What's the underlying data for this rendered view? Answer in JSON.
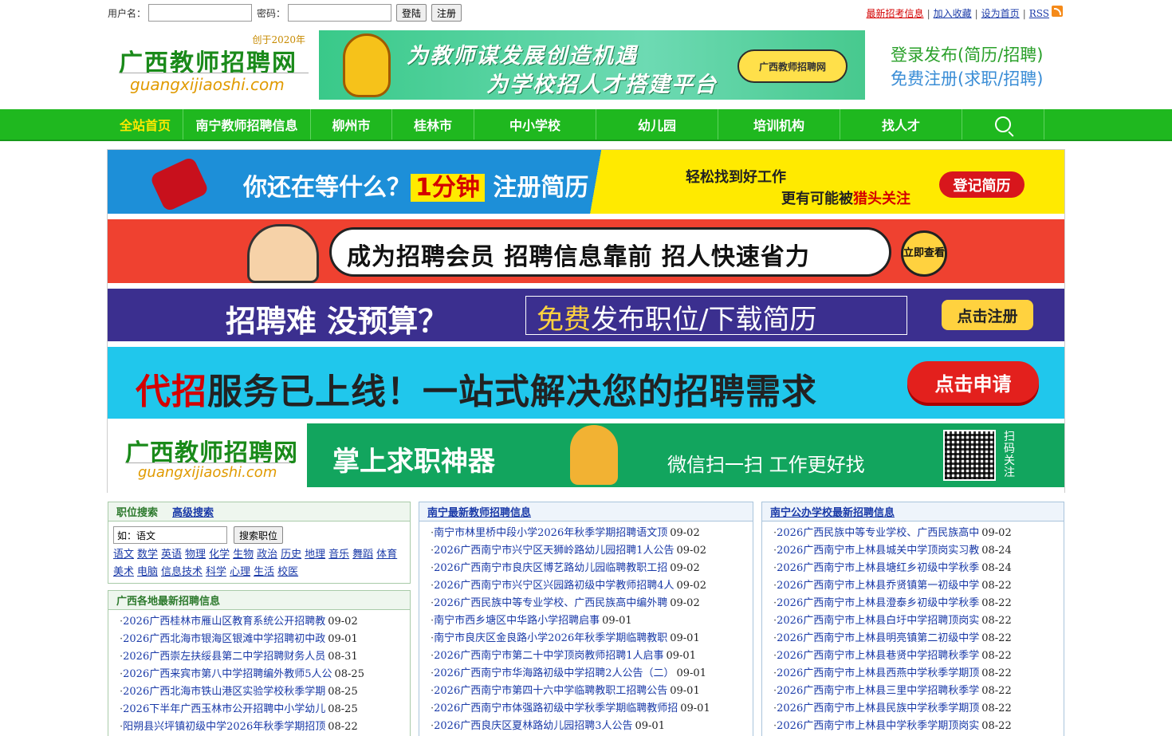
{
  "login": {
    "user_label": "用户名：",
    "pass_label": "密码：",
    "login_btn": "登陆",
    "register_btn": "注册"
  },
  "toplinks": {
    "latest": "最新招考信息",
    "favorite": "加入收藏",
    "homepage": "设为首页",
    "rss": "RSS",
    "sep": "|"
  },
  "logo": {
    "founded": "创于2020年",
    "cn": "广西教师招聘网",
    "en": "guangxijiaoshi.com"
  },
  "hero": {
    "line1": "为教师谋发展创造机遇",
    "line2": "为学校招人才搭建平台",
    "badge": "广西教师招聘网"
  },
  "header_right": {
    "login_post": "登录发布(简历/招聘)",
    "free_register": "免费注册(求职/招聘)"
  },
  "nav": [
    {
      "label": "全站首页",
      "width": 95
    },
    {
      "label": "南宁教师招聘信息",
      "width": 160
    },
    {
      "label": "柳州市",
      "width": 102
    },
    {
      "label": "桂林市",
      "width": 103
    },
    {
      "label": "中小学校",
      "width": 153
    },
    {
      "label": "幼儿园",
      "width": 153
    },
    {
      "label": "培训机构",
      "width": 153
    },
    {
      "label": "找人才",
      "width": 153
    }
  ],
  "ads": {
    "a1_main": "你还在等什么？",
    "a1_hl": "1分钟",
    "a1_tail": "注册简历",
    "a1_sub1": "轻松找到好工作",
    "a1_sub2a": "更有可能被",
    "a1_sub2b": "猎头关注",
    "a1_btn": "登记简历",
    "a2_text": "成为招聘会员  招聘信息靠前  招人快速省力",
    "a2_go": "立即查看",
    "a3_main": "招聘难 没预算？",
    "a3_free": "免费",
    "a3_rest": "发布职位/下载简历",
    "a3_btn": "点击注册",
    "a4_red": "代招",
    "a4_rest": "服务已上线！一站式解决您的招聘需求",
    "a4_btn": "点击申请",
    "a5_cn": "广西教师招聘网",
    "a5_en": "guangxijiaoshi.com",
    "a5_main": "掌上求职神器",
    "a5_sub": "微信扫一扫 工作更好找",
    "a5_scan": "扫码关注"
  },
  "search": {
    "title": "职位搜索",
    "advanced": "高级搜索",
    "placeholder": "如：语文",
    "button": "搜索职位",
    "tags": [
      "语文",
      "数学",
      "英语",
      "物理",
      "化学",
      "生物",
      "政治",
      "历史",
      "地理",
      "音乐",
      "舞蹈",
      "体育",
      "美术",
      "电脑",
      "信息技术",
      "科学",
      "心理",
      "生活",
      "校医"
    ]
  },
  "local": {
    "title": "广西各地最新招聘信息",
    "items": [
      {
        "t": "2026广西桂林市雁山区教育系统公开招聘教",
        "d": "09-02"
      },
      {
        "t": "2026广西北海市银海区银滩中学招聘初中政",
        "d": "09-01"
      },
      {
        "t": "2026广西崇左扶绥县第二中学招聘财务人员",
        "d": "08-31"
      },
      {
        "t": "2026广西来宾市第八中学招聘编外教师5人公",
        "d": "08-25"
      },
      {
        "t": "2026广西北海市铁山港区实验学校秋季学期",
        "d": "08-25"
      },
      {
        "t": "2026下半年广西玉林市公开招聘中小学幼儿",
        "d": "08-25"
      },
      {
        "t": "阳朔县兴坪镇初级中学2026年秋季学期招顶",
        "d": "08-22"
      }
    ]
  },
  "nanning": {
    "title": "南宁最新教师招聘信息",
    "items": [
      {
        "t": "南宁市林里桥中段小学2026年秋季学期招聘语文顶",
        "d": "09-02"
      },
      {
        "t": "2026广西南宁市兴宁区天狮岭路幼儿园招聘1人公告",
        "d": "09-02"
      },
      {
        "t": "2026广西南宁市良庆区博艺路幼儿园临聘教职工招",
        "d": "09-02"
      },
      {
        "t": "2026广西南宁市兴宁区兴园路初级中学教师招聘4人",
        "d": "09-02"
      },
      {
        "t": "2026广西民族中等专业学校、广西民族高中编外聘",
        "d": "09-02"
      },
      {
        "t": "南宁市西乡塘区中华路小学招聘启事",
        "d": "09-01"
      },
      {
        "t": "南宁市良庆区金良路小学2026年秋季学期临聘教职",
        "d": "09-01"
      },
      {
        "t": "2026广西南宁市第二十中学顶岗教师招聘1人启事",
        "d": "09-01"
      },
      {
        "t": "2026广西南宁市华海路初级中学招聘2人公告（二）",
        "d": "09-01"
      },
      {
        "t": "2026广西南宁市第四十六中学临聘教职工招聘公告",
        "d": "09-01"
      },
      {
        "t": "2026广西南宁市体强路初级中学秋季学期临聘教师招",
        "d": "09-01"
      },
      {
        "t": "2026广西良庆区夏林路幼儿园招聘3人公告",
        "d": "09-01"
      }
    ]
  },
  "public": {
    "title": "南宁公办学校最新招聘信息",
    "items": [
      {
        "t": "2026广西民族中等专业学校、广西民族高中",
        "d": "09-02"
      },
      {
        "t": "2026广西南宁市上林县城关中学顶岗实习教",
        "d": "08-24"
      },
      {
        "t": "2026广西南宁市上林县塘红乡初级中学秋季",
        "d": "08-24"
      },
      {
        "t": "2026广西南宁市上林县乔贤镇第一初级中学",
        "d": "08-22"
      },
      {
        "t": "2026广西南宁市上林县澄泰乡初级中学秋季",
        "d": "08-22"
      },
      {
        "t": "2026广西南宁市上林县白圩中学招聘顶岗实",
        "d": "08-22"
      },
      {
        "t": "2026广西南宁市上林县明亮镇第二初级中学",
        "d": "08-22"
      },
      {
        "t": "2026广西南宁市上林县巷贤中学招聘秋季学",
        "d": "08-22"
      },
      {
        "t": "2026广西南宁市上林县西燕中学秋季学期顶",
        "d": "08-22"
      },
      {
        "t": "2026广西南宁市上林县三里中学招聘秋季学",
        "d": "08-22"
      },
      {
        "t": "2026广西南宁市上林县民族中学秋季学期顶",
        "d": "08-22"
      },
      {
        "t": "2026广西南宁市上林县中学秋季学期顶岗实",
        "d": "08-22"
      }
    ]
  }
}
